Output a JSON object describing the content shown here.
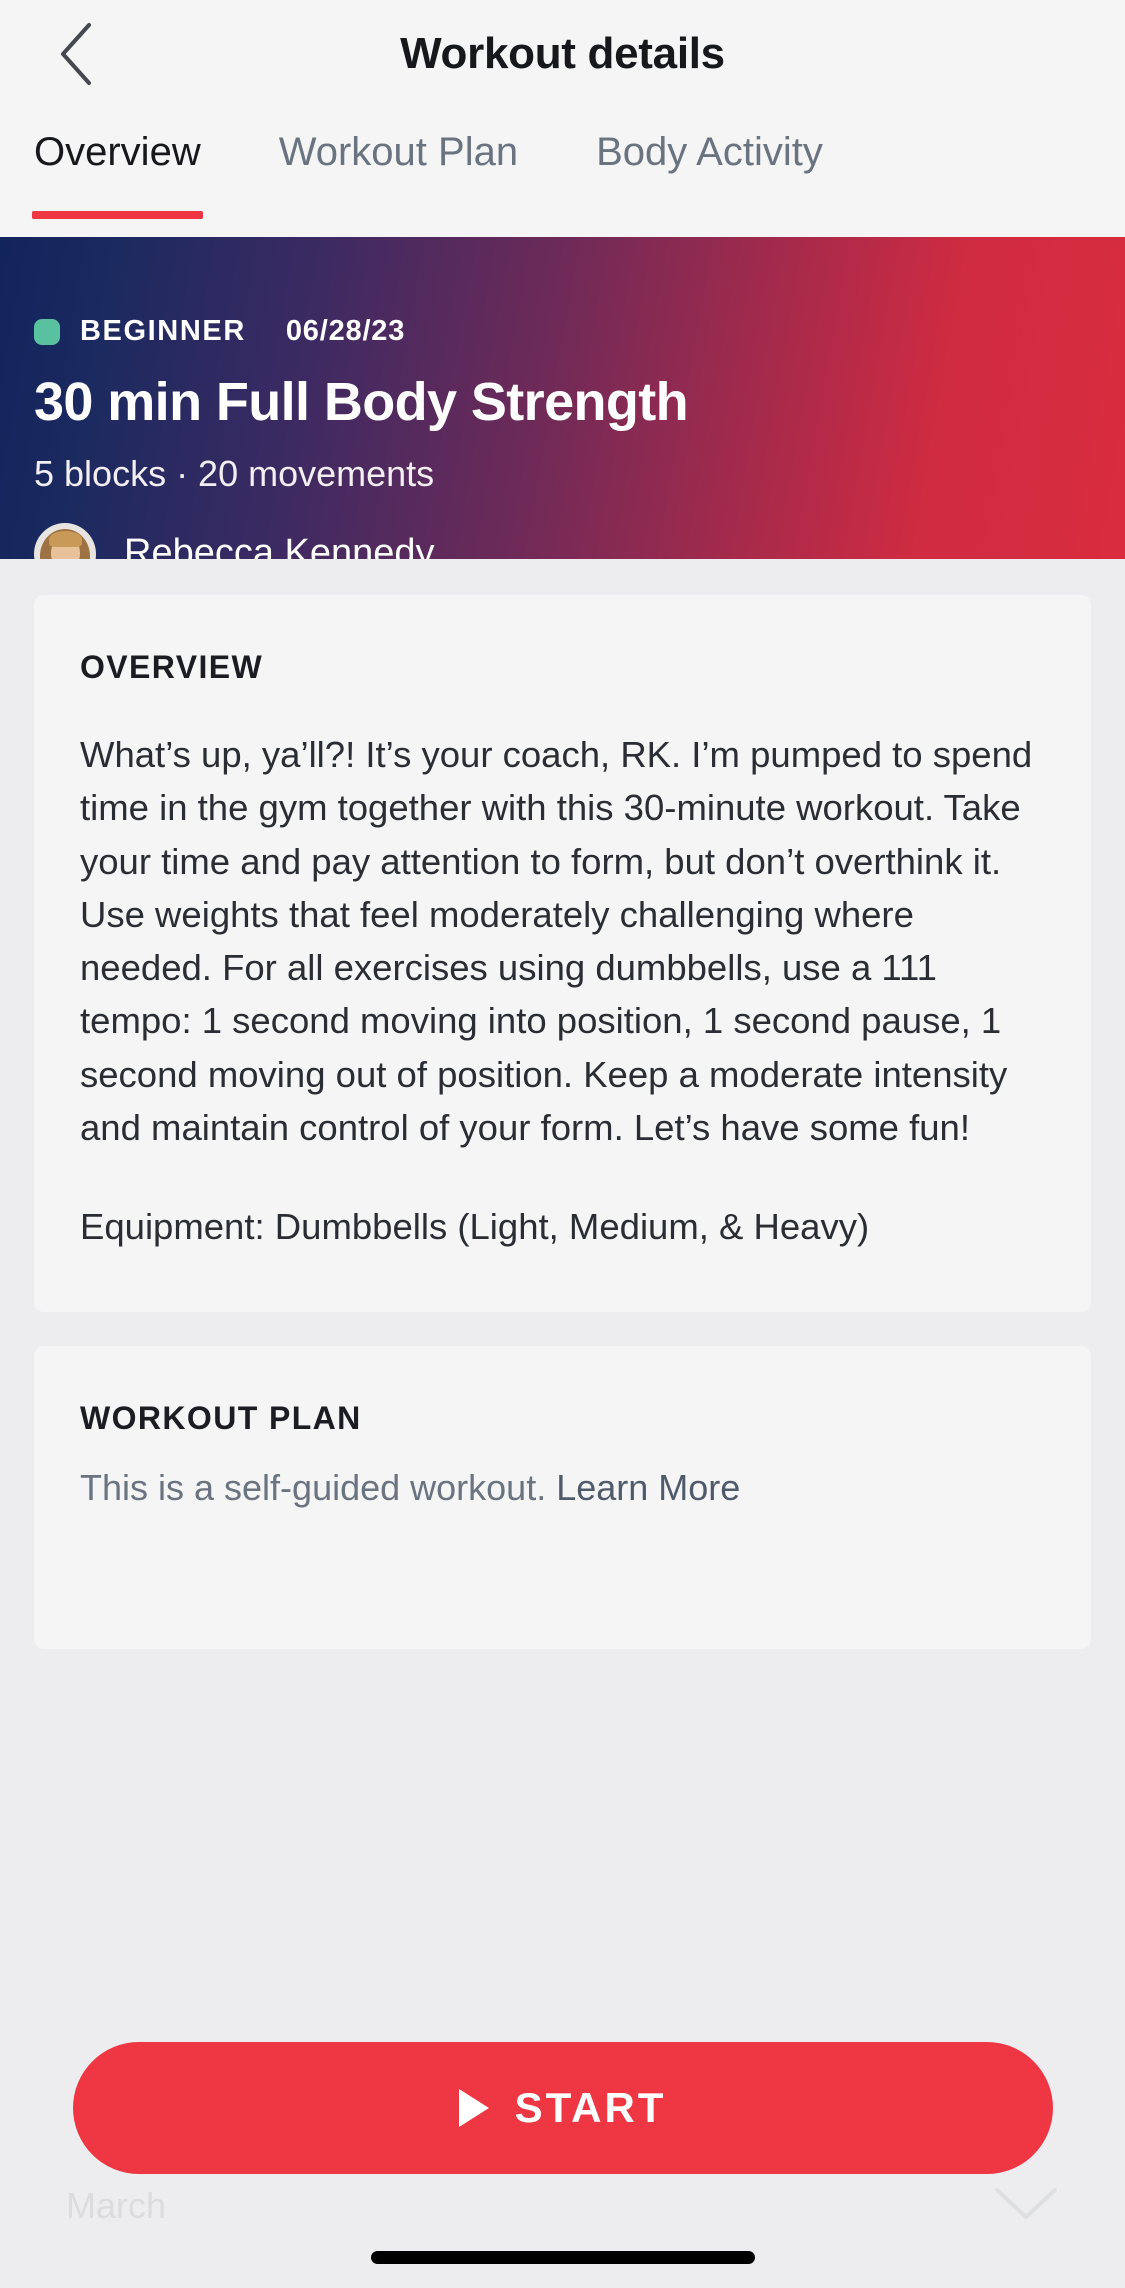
{
  "navbar": {
    "title": "Workout details",
    "back_icon": "chevron-left-icon"
  },
  "tabs": [
    {
      "label": "Overview",
      "active": true
    },
    {
      "label": "Workout Plan",
      "active": false
    },
    {
      "label": "Body Activity",
      "active": false
    }
  ],
  "hero": {
    "level": "BEGINNER",
    "date": "06/28/23",
    "title": "30 min Full Body Strength",
    "subtitle": "5 blocks  ·  20 movements",
    "instructor": "Rebecca Kennedy",
    "level_dot_color": "#5ac1a0",
    "gradient_start": "#12245c",
    "gradient_end": "#da2c3e"
  },
  "overview_card": {
    "heading": "OVERVIEW",
    "paragraph_1": "What’s up, ya’ll?! It’s your coach, RK. I’m pumped to spend time in the gym together with this 30-minute workout. Take your time and pay attention to form, but don’t overthink it. Use weights that feel moderately challenging where needed. For all exercises using dumbbells, use a 111 tempo: 1 second moving into position, 1 second pause, 1 second moving out of position. Keep a moderate intensity and maintain control of your form. Let’s have some fun!",
    "paragraph_2": "Equipment: Dumbbells (Light, Medium, & Heavy)"
  },
  "plan_card": {
    "heading": "WORKOUT PLAN",
    "text": "This is a self-guided workout. ",
    "link": "Learn More"
  },
  "bottom": {
    "month": "March",
    "chevron_icon": "chevron-down-icon"
  },
  "start_button": {
    "label": "START",
    "icon": "play-icon",
    "color": "#ee3742"
  }
}
